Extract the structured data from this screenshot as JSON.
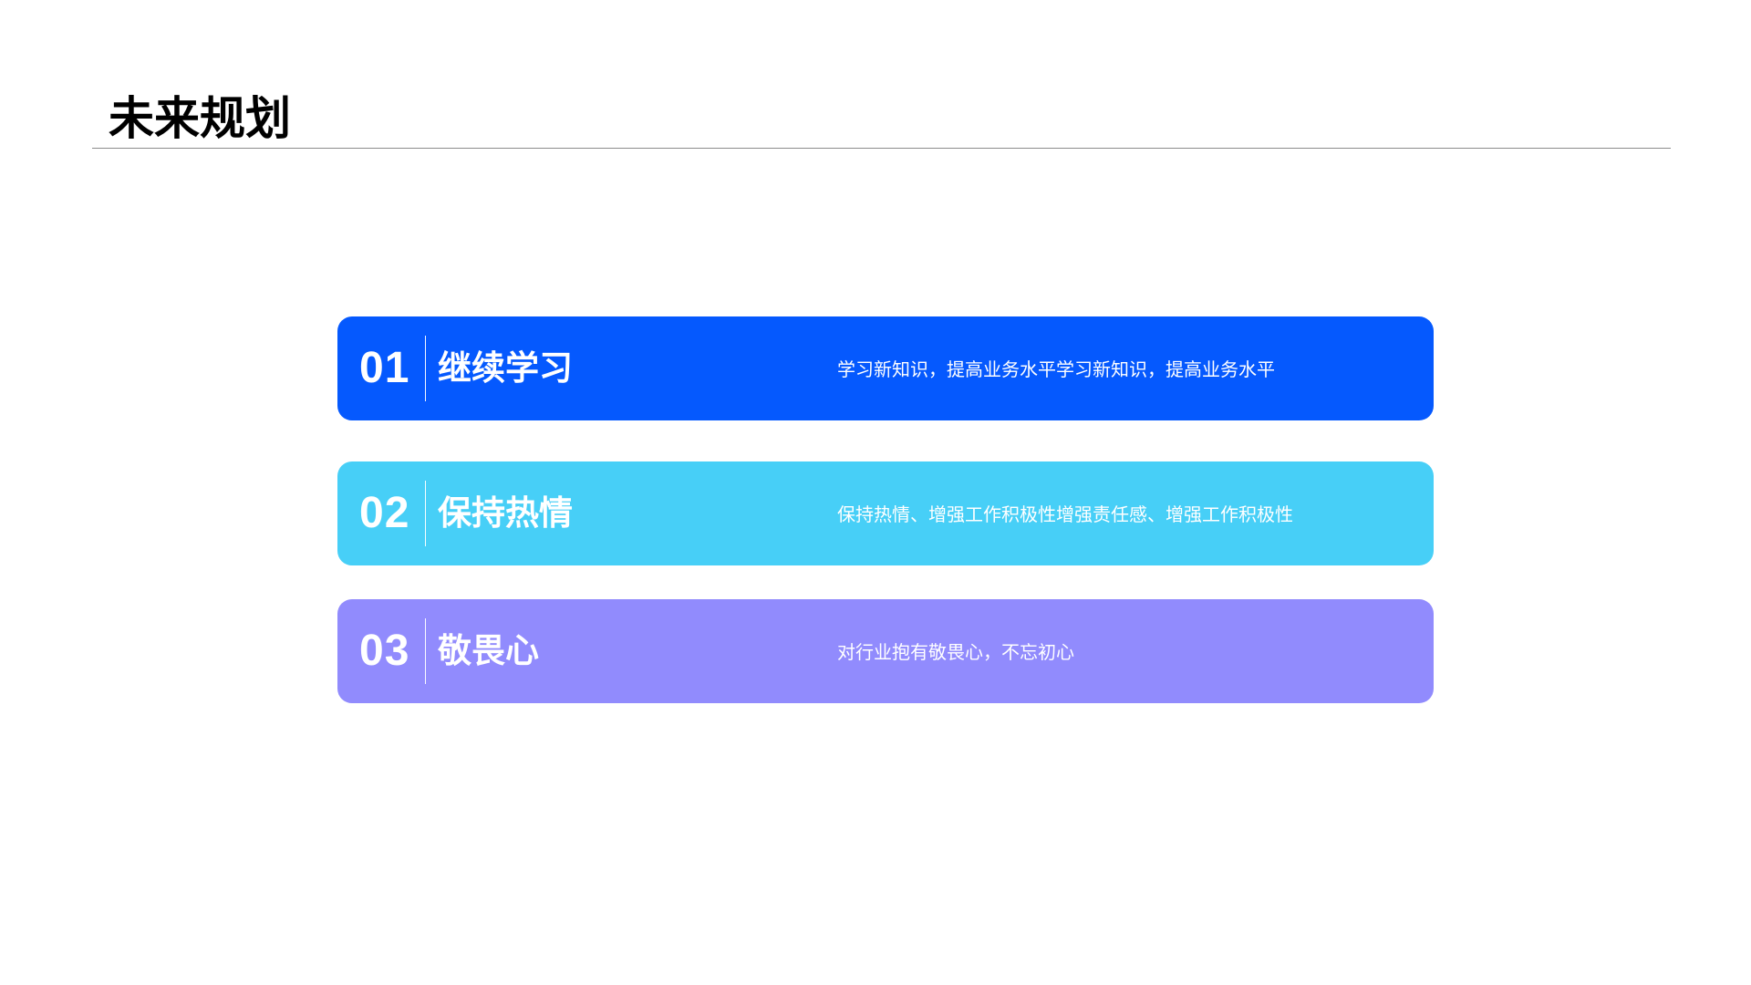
{
  "slide": {
    "title": "未来规划"
  },
  "items": [
    {
      "number": "01",
      "heading": "继续学习",
      "description": "学习新知识，提高业务水平学习新知识，提高业务水平",
      "color": "#0559fe"
    },
    {
      "number": "02",
      "heading": "保持热情",
      "description": "保持热情、增强工作积极性增强责任感、增强工作积极性",
      "color": "#47cff7"
    },
    {
      "number": "03",
      "heading": "敬畏心",
      "description": "对行业抱有敬畏心，不忘初心",
      "color": "#918bfd"
    }
  ]
}
